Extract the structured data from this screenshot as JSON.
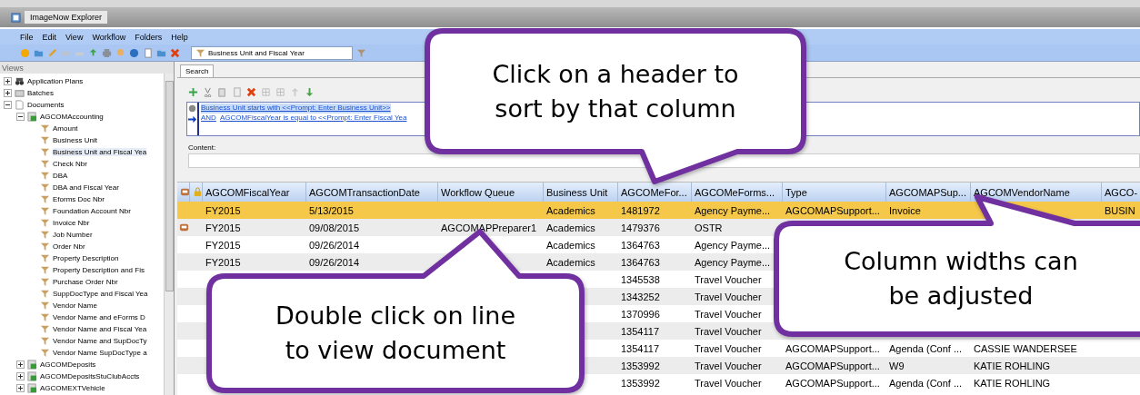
{
  "window": {
    "title": "ImageNow Explorer"
  },
  "menu": [
    "File",
    "Edit",
    "View",
    "Workflow",
    "Folders",
    "Help"
  ],
  "toolbar": {
    "view_select": "Business Unit and Fiscal Year"
  },
  "views_pane": {
    "title": "Views",
    "tree": [
      {
        "label": "Application Plans",
        "kind": "plans",
        "expanded": false
      },
      {
        "label": "Batches",
        "kind": "batches",
        "expanded": false
      },
      {
        "label": "Documents",
        "kind": "documents",
        "expanded": true,
        "children": [
          {
            "label": "AGCOMAccounting",
            "kind": "drawer",
            "expanded": true,
            "children": [
              {
                "label": "Amount",
                "kind": "view",
                "selected": false
              },
              {
                "label": "Business Unit",
                "kind": "view",
                "selected": false
              },
              {
                "label": "Business Unit and Fiscal Yea",
                "kind": "view",
                "selected": true
              },
              {
                "label": "Check Nbr",
                "kind": "view",
                "selected": false
              },
              {
                "label": "DBA",
                "kind": "view",
                "selected": false
              },
              {
                "label": "DBA and Fiscal Year",
                "kind": "view",
                "selected": false
              },
              {
                "label": "Eforms Doc Nbr",
                "kind": "view",
                "selected": false
              },
              {
                "label": "Foundation Account Nbr",
                "kind": "view",
                "selected": false
              },
              {
                "label": "Invoice Nbr",
                "kind": "view",
                "selected": false
              },
              {
                "label": "Job Number",
                "kind": "view",
                "selected": false
              },
              {
                "label": "Order Nbr",
                "kind": "view",
                "selected": false
              },
              {
                "label": "Property Description",
                "kind": "view",
                "selected": false
              },
              {
                "label": "Property Description and Fis",
                "kind": "view",
                "selected": false
              },
              {
                "label": "Purchase Order Nbr",
                "kind": "view",
                "selected": false
              },
              {
                "label": "SuppDocType and Fiscal Yea",
                "kind": "view",
                "selected": false
              },
              {
                "label": "Vendor Name",
                "kind": "view",
                "selected": false
              },
              {
                "label": "Vendor Name and eForms D",
                "kind": "view",
                "selected": false
              },
              {
                "label": "Vendor Name and Fiscal Yea",
                "kind": "view",
                "selected": false
              },
              {
                "label": "Vendor Name and SupDocTy",
                "kind": "view",
                "selected": false
              },
              {
                "label": "Vendor Name SupDocType a",
                "kind": "view",
                "selected": false
              }
            ]
          },
          {
            "label": "AGCOMDeposits",
            "kind": "drawer",
            "expanded": false
          },
          {
            "label": "AGCOMDepositsStuClubAccts",
            "kind": "drawer",
            "expanded": false
          },
          {
            "label": "AGCOMEXTVehicle",
            "kind": "drawer",
            "expanded": false
          }
        ]
      }
    ]
  },
  "search_tab": {
    "label": "Search",
    "selected": true
  },
  "criteria": [
    {
      "text": "Business Unit starts with <<Prompt: Enter Business Unit>>"
    },
    {
      "connector": "AND",
      "text": "AGCOMFiscalYear is equal to <<Prompt: Enter Fiscal Yea"
    }
  ],
  "content": {
    "label": "Content:"
  },
  "table": {
    "columns": [
      "AGCOMFiscalYear",
      "AGCOMTransactionDate",
      "Workflow Queue",
      "Business Unit",
      "AGCOMeFor...",
      "AGCOMeForms...",
      "Type",
      "AGCOMAPSup...",
      "AGCOMVendorName",
      "AGCO-"
    ],
    "rows": [
      {
        "selected": true,
        "in_workflow": false,
        "cells": [
          "FY2015",
          "5/13/2015",
          null,
          "Academics",
          "1481972",
          "Agency Payme...",
          "AGCOMAPSupport...",
          "Invoice",
          null,
          "BUSIN"
        ]
      },
      {
        "selected": false,
        "in_workflow": true,
        "cells": [
          "FY2015",
          "09/08/2015",
          "AGCOMAPPreparer1",
          "Academics",
          "1479376",
          "OSTR",
          null,
          null,
          null,
          null
        ]
      },
      {
        "selected": false,
        "in_workflow": false,
        "cells": [
          "FY2015",
          "09/26/2014",
          null,
          "Academics",
          "1364763",
          "Agency Payme...",
          null,
          null,
          null,
          null
        ]
      },
      {
        "selected": false,
        "in_workflow": false,
        "cells": [
          "FY2015",
          "09/26/2014",
          null,
          "Academics",
          "1364763",
          "Agency Payme...",
          null,
          null,
          null,
          null
        ]
      },
      {
        "selected": false,
        "in_workflow": false,
        "cells": [
          null,
          null,
          null,
          null,
          "1345538",
          "Travel Voucher",
          null,
          null,
          null,
          null
        ]
      },
      {
        "selected": false,
        "in_workflow": false,
        "cells": [
          null,
          null,
          null,
          null,
          "1343252",
          "Travel Voucher",
          null,
          null,
          null,
          null
        ]
      },
      {
        "selected": false,
        "in_workflow": false,
        "cells": [
          null,
          null,
          null,
          null,
          "1370996",
          "Travel Voucher",
          null,
          null,
          null,
          null
        ]
      },
      {
        "selected": false,
        "in_workflow": false,
        "cells": [
          null,
          null,
          null,
          null,
          "1354117",
          "Travel Voucher",
          null,
          null,
          null,
          null
        ]
      },
      {
        "selected": false,
        "in_workflow": false,
        "cells": [
          null,
          null,
          null,
          null,
          "1354117",
          "Travel Voucher",
          "AGCOMAPSupport...",
          "Agenda (Conf ...",
          "CASSIE WANDERSEE",
          null
        ]
      },
      {
        "selected": false,
        "in_workflow": false,
        "cells": [
          null,
          null,
          null,
          null,
          "1353992",
          "Travel Voucher",
          "AGCOMAPSupport...",
          "W9",
          "KATIE ROHLING",
          null
        ]
      },
      {
        "selected": false,
        "in_workflow": false,
        "cells": [
          null,
          null,
          null,
          null,
          "1353992",
          "Travel Voucher",
          "AGCOMAPSupport...",
          "Agenda (Conf ...",
          "KATIE ROHLING",
          null
        ]
      }
    ]
  },
  "callouts": [
    {
      "lines": [
        "Click on a header to",
        "sort by that column"
      ]
    },
    {
      "lines": [
        "Double click on line",
        "to view document"
      ]
    },
    {
      "lines": [
        "Column widths can",
        "be adjusted"
      ]
    }
  ]
}
